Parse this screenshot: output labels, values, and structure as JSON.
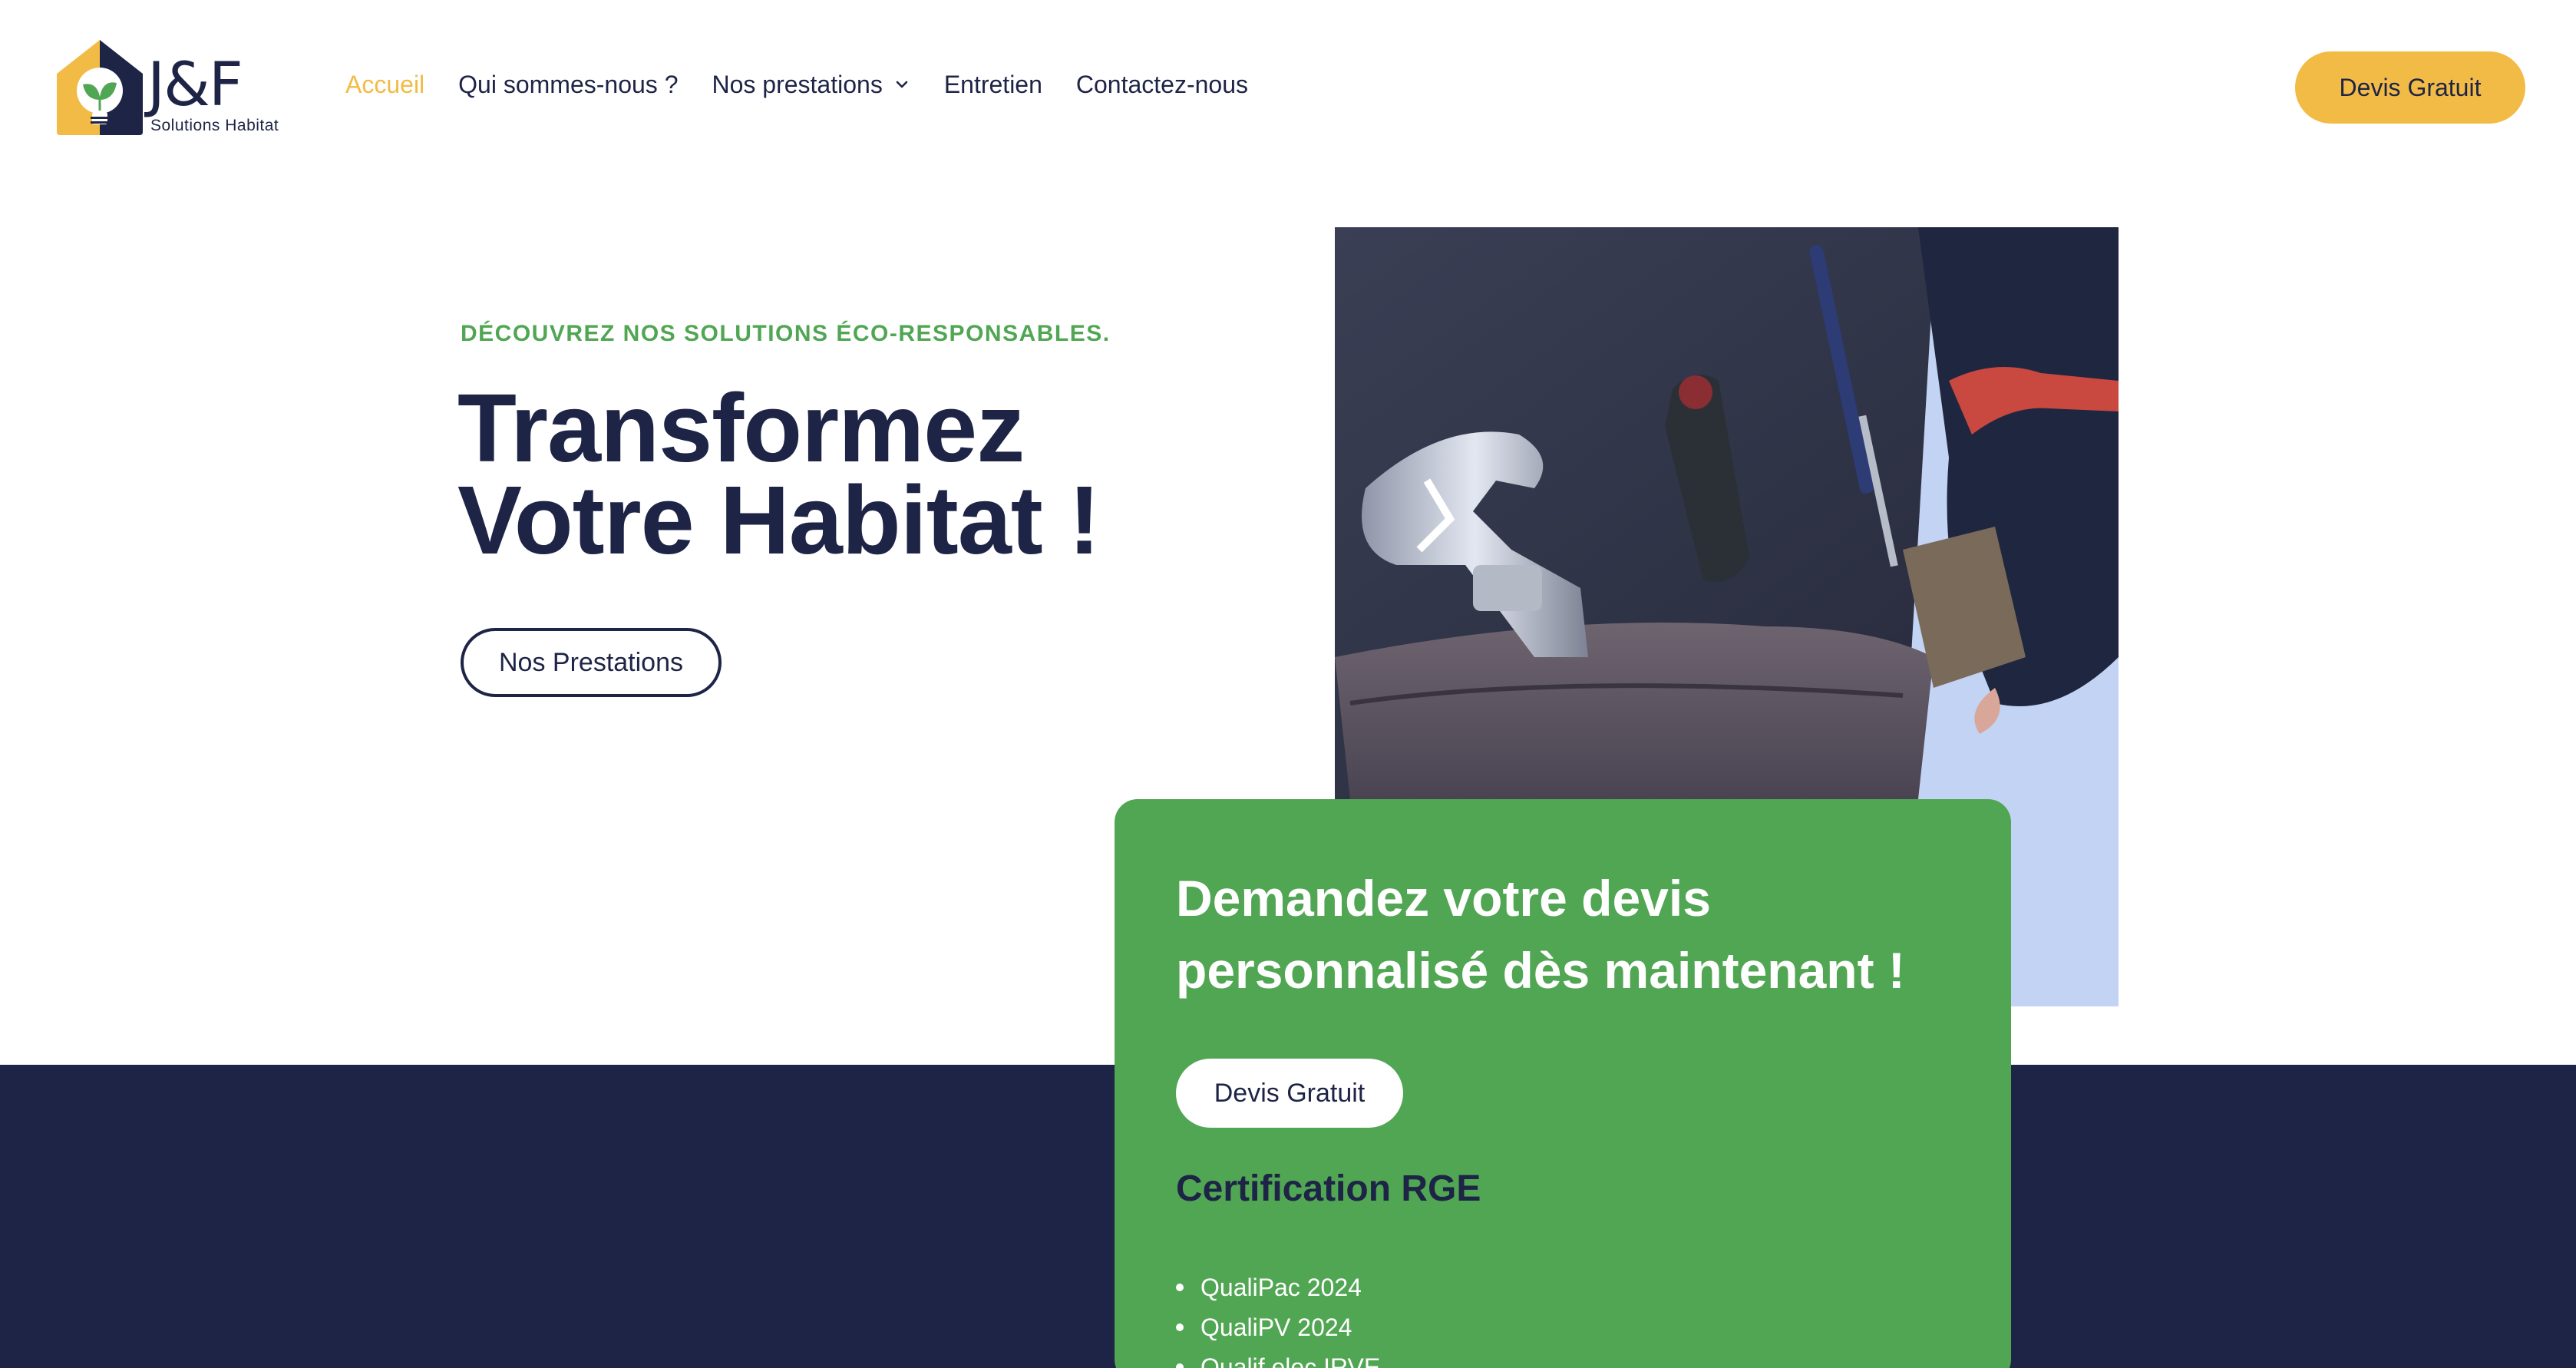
{
  "brand": {
    "logo_text": "J&F",
    "logo_subtitle": "Solutions Habitat",
    "colors": {
      "navy": "#1d2446",
      "yellow": "#f2bb45",
      "green": "#51a653",
      "light_blue": "#c3d3f4"
    }
  },
  "nav": {
    "items": [
      {
        "label": "Accueil",
        "active": true
      },
      {
        "label": "Qui sommes-nous ?"
      },
      {
        "label": "Nos prestations",
        "has_dropdown": true
      },
      {
        "label": "Entretien"
      },
      {
        "label": "Contactez-nous"
      }
    ],
    "cta_label": "Devis Gratuit"
  },
  "hero": {
    "eyebrow": "DÉCOUVREZ NOS SOLUTIONS ÉCO-RESPONSABLES.",
    "title_line1": "Transformez",
    "title_line2": "Votre Habitat !",
    "button_label": "Nos Prestations",
    "image_icon": "tool-belt-image"
  },
  "card": {
    "title_line1": "Demandez votre devis",
    "title_line2": "personnalisé dès maintenant !",
    "button_label": "Devis Gratuit",
    "cert_title": "Certification RGE",
    "cert_items": [
      "QualiPac 2024",
      "QualiPV 2024",
      "Qualif elec IRVE"
    ]
  }
}
